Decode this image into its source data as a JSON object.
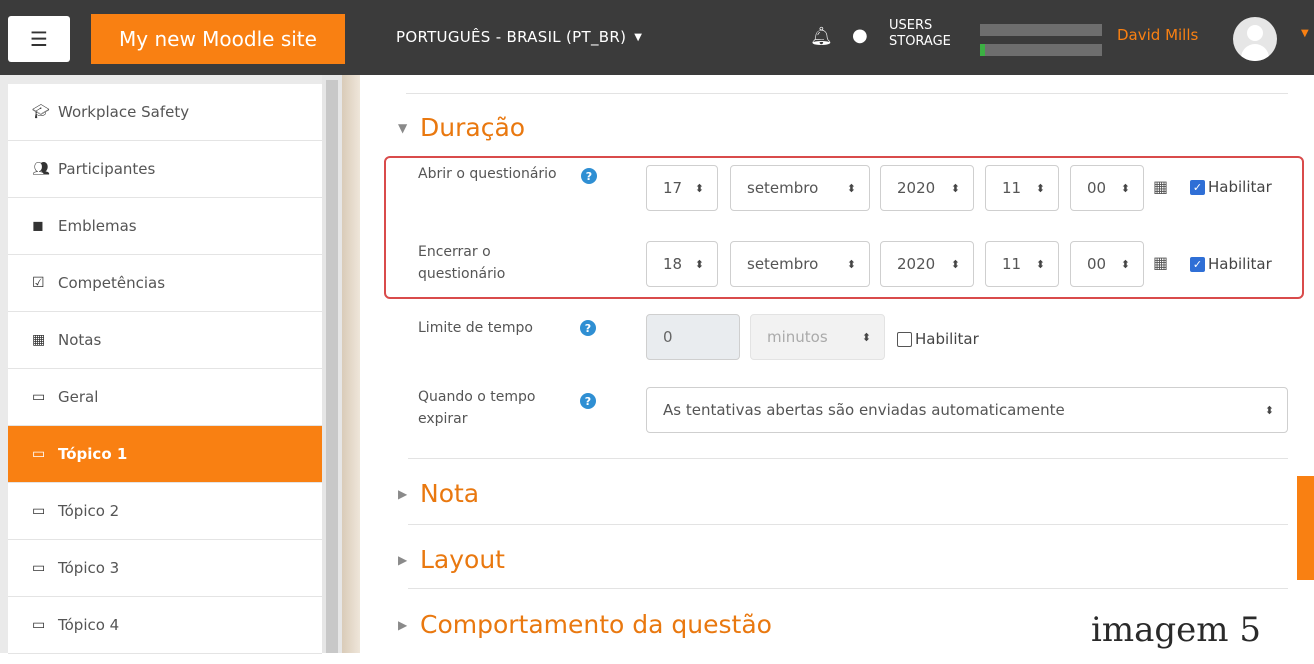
{
  "navbar": {
    "brand": "My new Moodle site",
    "language": "PORTUGUÊS - BRASIL (PT_BR)",
    "storage_line1": "USERS",
    "storage_line2": "STORAGE",
    "user_name": "David Mills",
    "icons": {
      "menu": "hamburger-icon",
      "notifications": "bell-icon",
      "messages": "chat-icon"
    },
    "colors": {
      "brand": "#f98012",
      "bar": "#3b3b3b"
    }
  },
  "sidebar": {
    "items": [
      {
        "label": "Workplace Safety",
        "icon": "graduation-cap-icon",
        "active": false
      },
      {
        "label": "Participantes",
        "icon": "users-icon",
        "active": false
      },
      {
        "label": "Emblemas",
        "icon": "shield-icon",
        "active": false
      },
      {
        "label": "Competências",
        "icon": "checkbox-icon",
        "active": false
      },
      {
        "label": "Notas",
        "icon": "table-icon",
        "active": false
      },
      {
        "label": "Geral",
        "icon": "folder-icon",
        "active": false
      },
      {
        "label": "Tópico 1",
        "icon": "folder-icon",
        "active": true
      },
      {
        "label": "Tópico 2",
        "icon": "folder-icon",
        "active": false
      },
      {
        "label": "Tópico 3",
        "icon": "folder-icon",
        "active": false
      },
      {
        "label": "Tópico 4",
        "icon": "folder-icon",
        "active": false
      }
    ]
  },
  "form": {
    "section_duracao": "Duração",
    "open": {
      "label": "Abrir o questionário",
      "day": "17",
      "month": "setembro",
      "year": "2020",
      "hour": "11",
      "minute": "00",
      "enable_label": "Habilitar",
      "enabled": true
    },
    "close": {
      "label": "Encerrar o questionário",
      "day": "18",
      "month": "setembro",
      "year": "2020",
      "hour": "11",
      "minute": "00",
      "enable_label": "Habilitar",
      "enabled": true
    },
    "time_limit": {
      "label": "Limite de tempo",
      "value": "0",
      "unit": "minutos",
      "enable_label": "Habilitar",
      "enabled": false
    },
    "when_expires": {
      "label": "Quando o tempo expirar",
      "value": "As tentativas abertas são enviadas automaticamente"
    },
    "section_nota": "Nota",
    "section_layout": "Layout",
    "section_comportamento": "Comportamento da questão"
  },
  "caption": "imagem 5",
  "accent_color": "#e9780f",
  "highlight_color": "#d94b4b"
}
